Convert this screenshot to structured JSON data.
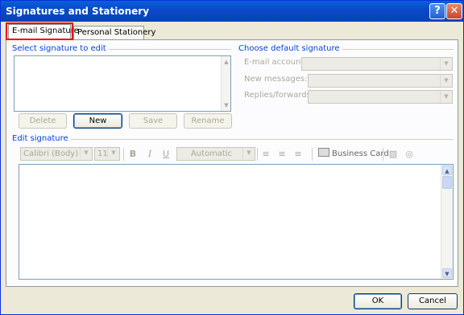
{
  "window": {
    "title": "Signatures and Stationery",
    "help_glyph": "?",
    "close_glyph": "✕"
  },
  "tabs": [
    {
      "label": "E-mail Signature",
      "active": true
    },
    {
      "label": "Personal Stationery",
      "active": false
    }
  ],
  "select_group": {
    "label": "Select signature to edit",
    "buttons": {
      "delete": "Delete",
      "new": "New",
      "save": "Save",
      "rename": "Rename"
    }
  },
  "default_group": {
    "label": "Choose default signature",
    "fields": {
      "email_account": "E-mail account:",
      "new_messages": "New messages:",
      "replies_forwards": "Replies/forwards:"
    }
  },
  "edit_group": {
    "label": "Edit signature",
    "toolbar": {
      "font": "Calibri (Body)",
      "size": "11",
      "bold": "B",
      "italic": "I",
      "underline": "U",
      "color": "Automatic",
      "business_card": "Business Card"
    }
  },
  "footer": {
    "ok": "OK",
    "cancel": "Cancel"
  },
  "colors": {
    "title_bar": "#0a5fd9",
    "group_label": "#0046d5",
    "highlight": "#ee0000"
  }
}
